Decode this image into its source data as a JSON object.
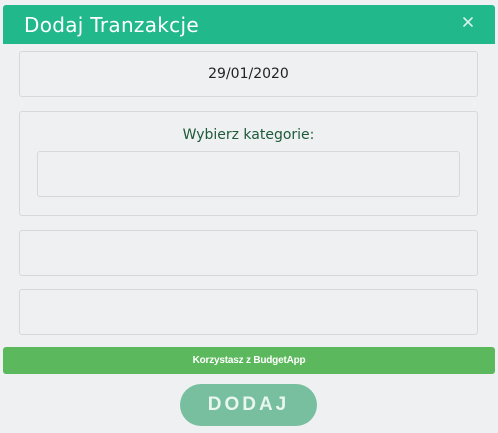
{
  "dialog": {
    "title": "Dodaj Tranzakcje"
  },
  "form": {
    "date": "29/01/2020",
    "category_label": "Wybierz kategorie:",
    "category_selected": "",
    "amount_value": "",
    "description_value": ""
  },
  "footer": {
    "text": "Korzystasz z BudgetApp"
  },
  "actions": {
    "add_label": "DODAJ"
  },
  "icons": {
    "close": "close-icon"
  },
  "colors": {
    "header_bg": "#21b88b",
    "footer_bg": "#5cb85c",
    "button_bg": "#77bf9e",
    "background": "#eef0f2"
  }
}
